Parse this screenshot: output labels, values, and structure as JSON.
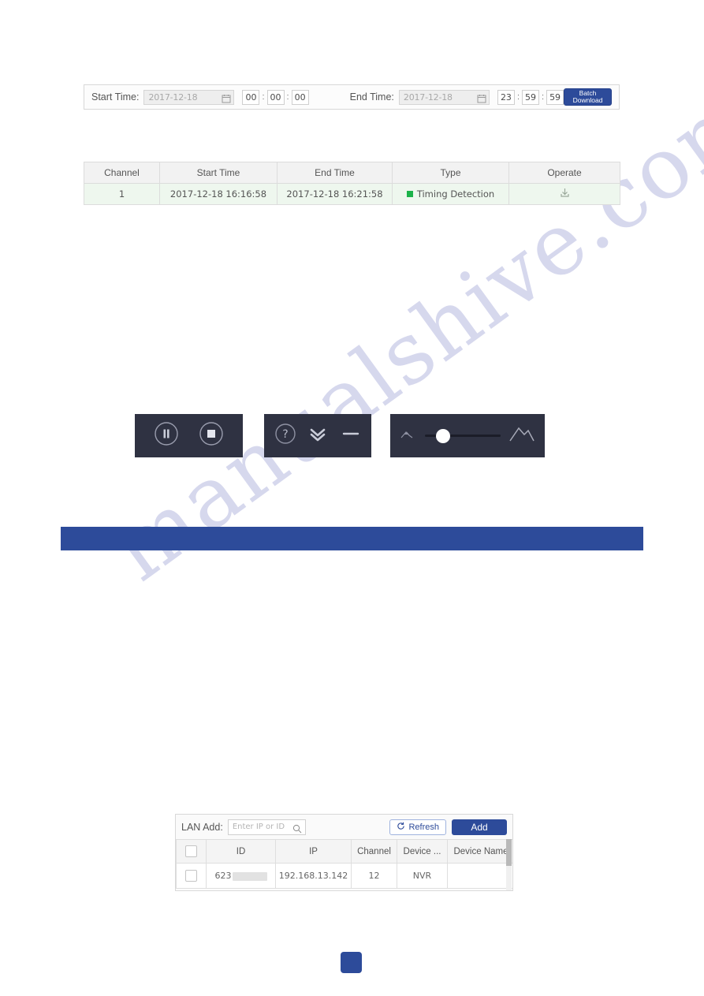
{
  "watermark": {
    "text": "manualshive.com"
  },
  "time_toolbar": {
    "start_label": "Start Time:",
    "start_date": "2017-12-18",
    "start_hour": "00",
    "start_minute": "00",
    "start_second": "00",
    "end_label": "End Time:",
    "end_date": "2017-12-18",
    "end_hour": "23",
    "end_minute": "59",
    "end_second": "59",
    "separator": ":",
    "batch_download_line1": "Batch",
    "batch_download_line2": "Download",
    "calendar_icon": "calendar-icon",
    "accent_color": "#2d4b9a"
  },
  "results_table": {
    "headers": [
      "Channel",
      "Start Time",
      "End Time",
      "Type",
      "Operate"
    ],
    "rows": [
      {
        "channel": "1",
        "start_time": "2017-12-18 16:16:58",
        "end_time": "2017-12-18 16:21:58",
        "type": "Timing Detection",
        "type_color": "#1cb34a",
        "operate_icon": "download-icon"
      }
    ],
    "row_bg": "#eef7ee",
    "header_bg": "#f2f2f2"
  },
  "playback_controls": {
    "panel_bg": "#2f3242",
    "buttons": [
      {
        "name": "pause-icon",
        "label": "Pause"
      },
      {
        "name": "stop-icon",
        "label": "Stop"
      }
    ]
  },
  "window_controls": {
    "panel_bg": "#2f3242",
    "buttons": [
      {
        "name": "help-icon",
        "label": "Help"
      },
      {
        "name": "double-chevron-down-icon",
        "label": "Collapse"
      },
      {
        "name": "minimize-icon",
        "label": "Minimize"
      }
    ]
  },
  "zoom_slider": {
    "panel_bg": "#2f3242",
    "min_icon": "small-image-icon",
    "max_icon": "large-image-icon",
    "value_percent": 24
  },
  "section_bar": {
    "color": "#2d4b9a",
    "text": ""
  },
  "lan_add": {
    "label": "LAN Add:",
    "search_placeholder": "Enter IP or ID",
    "search_value": "",
    "search_icon": "search-icon",
    "refresh_label": "Refresh",
    "refresh_icon": "refresh-icon",
    "add_label": "Add",
    "accent_color": "#2d4b9a"
  },
  "device_table": {
    "headers": [
      "",
      "ID",
      "IP",
      "Channel",
      "Device ...",
      "Device Name"
    ],
    "rows": [
      {
        "selected": false,
        "id": "623",
        "id_redacted": true,
        "ip": "192.168.13.142",
        "channel": "12",
        "device_type": "NVR",
        "device_name": ""
      }
    ]
  },
  "page_badge": {
    "label": "",
    "color": "#2d4b9a"
  }
}
